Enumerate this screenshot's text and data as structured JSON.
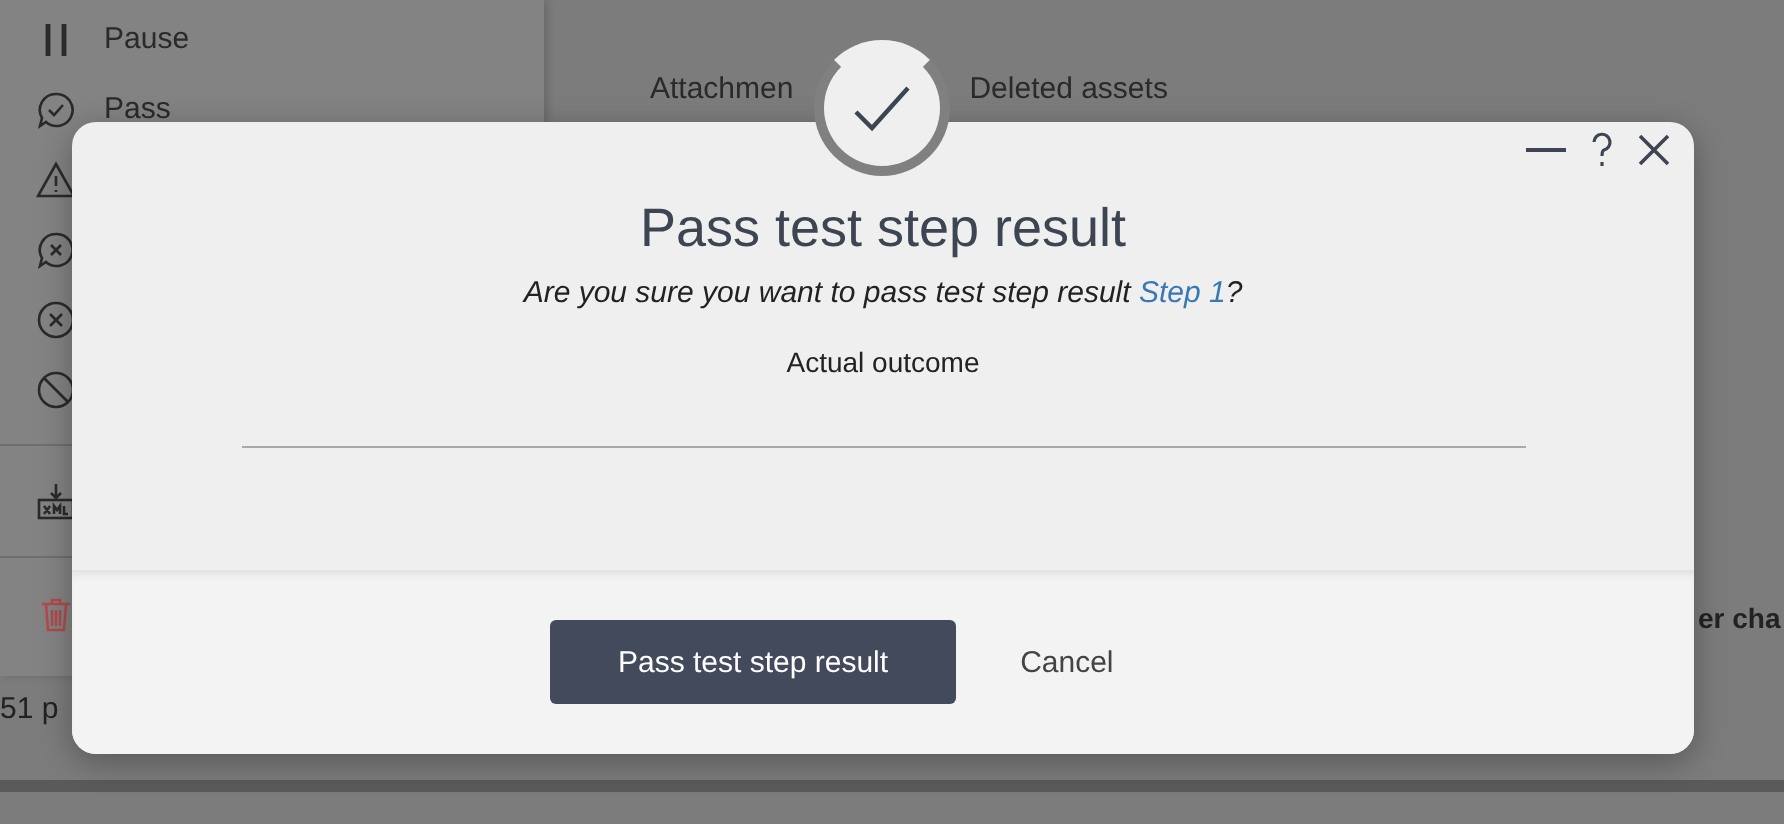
{
  "background": {
    "menu": [
      {
        "kind": "pause",
        "label": "Pause"
      },
      {
        "kind": "pass",
        "label": "Pass"
      },
      {
        "kind": "warning"
      },
      {
        "kind": "fail"
      },
      {
        "kind": "cancel"
      },
      {
        "kind": "block"
      },
      {
        "kind": "xml"
      },
      {
        "kind": "delete"
      }
    ],
    "tabs": [
      "Attachmen",
      "Deleted assets"
    ],
    "time": "51 p",
    "column_fragment": "er cha"
  },
  "dialog": {
    "title": "Pass test step result",
    "question": "Are you sure you want to pass test step result ",
    "link": "Step 1",
    "question_end": "?",
    "field_label": "Actual outcome",
    "buttons": [
      {
        "kind": "primary",
        "label": "Pass test step result"
      },
      {
        "kind": "plain",
        "label": "Cancel"
      }
    ]
  }
}
